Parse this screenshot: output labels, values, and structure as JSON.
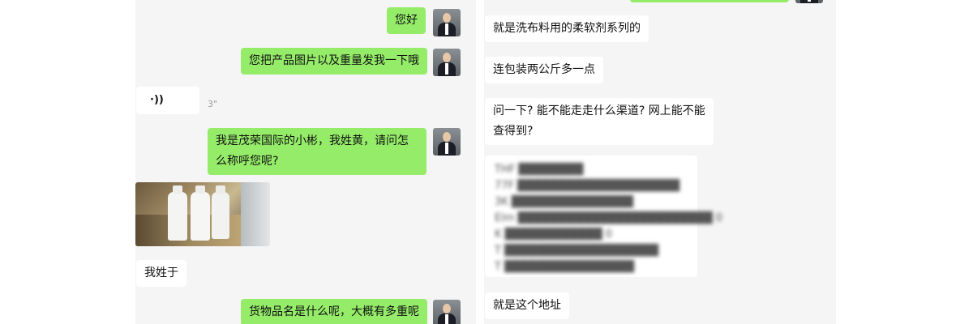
{
  "left_chat": {
    "msg1": "您好",
    "msg2": "您把产品图片以及重量发我一下哦",
    "voice_duration": "3\"",
    "msg3": "我是茂荣国际的小彬，我姓黄，请问怎么称呼您呢?",
    "msg4": "我姓于",
    "msg5": "货物品名是什么呢，大概有多重呢"
  },
  "right_chat": {
    "msg1": "就是洗布料用的柔软剂系列的",
    "msg2": "连包装两公斤多一点",
    "msg3": "问一下? 能不能走走什么渠道? 网上能不能查得到?",
    "address_lines": [
      "THF ████████",
      "77F ████████████████████",
      "3K ███████████████",
      "Elm ████████████████████████ 0",
      "K ████████████ 0",
      "T ███████████████████",
      "T ████████████████"
    ],
    "msg4": "就是这个地址"
  },
  "colors": {
    "sent_bubble": "#95ec69",
    "received_bubble": "#ffffff",
    "panel_bg": "#f5f5f5"
  }
}
